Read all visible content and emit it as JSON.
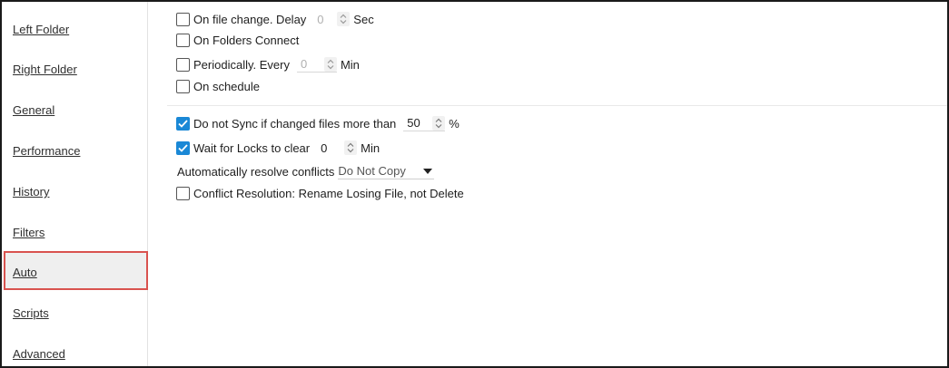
{
  "sidebar": {
    "items": [
      {
        "label": "Left Folder"
      },
      {
        "label": "Right Folder"
      },
      {
        "label": "General"
      },
      {
        "label": "Performance"
      },
      {
        "label": "History"
      },
      {
        "label": "Filters"
      },
      {
        "label": "Auto",
        "selected": true
      },
      {
        "label": "Scripts"
      },
      {
        "label": "Advanced"
      }
    ],
    "selected_border_color": "#d9534f"
  },
  "triggers": {
    "on_file_change": {
      "label": "On file change. Delay",
      "checked": false,
      "value": "0",
      "unit": "Sec"
    },
    "on_folders_connect": {
      "label": "On Folders Connect",
      "checked": false
    },
    "periodically": {
      "label": "Periodically. Every",
      "checked": false,
      "value": "0",
      "unit": "Min"
    },
    "on_schedule": {
      "label": "On schedule",
      "checked": false
    }
  },
  "options": {
    "do_not_sync": {
      "label": "Do not Sync if changed files more than",
      "checked": true,
      "value": "50",
      "unit": "%"
    },
    "wait_for_locks": {
      "label": "Wait for Locks to clear",
      "checked": true,
      "value": "0",
      "unit": "Min"
    },
    "resolve_conflicts": {
      "label": "Automatically resolve conflicts",
      "selected": "Do Not Copy"
    },
    "conflict_resolution": {
      "label": "Conflict Resolution: Rename Losing File, not Delete",
      "checked": false
    }
  },
  "colors": {
    "accent": "#1a88d6"
  }
}
